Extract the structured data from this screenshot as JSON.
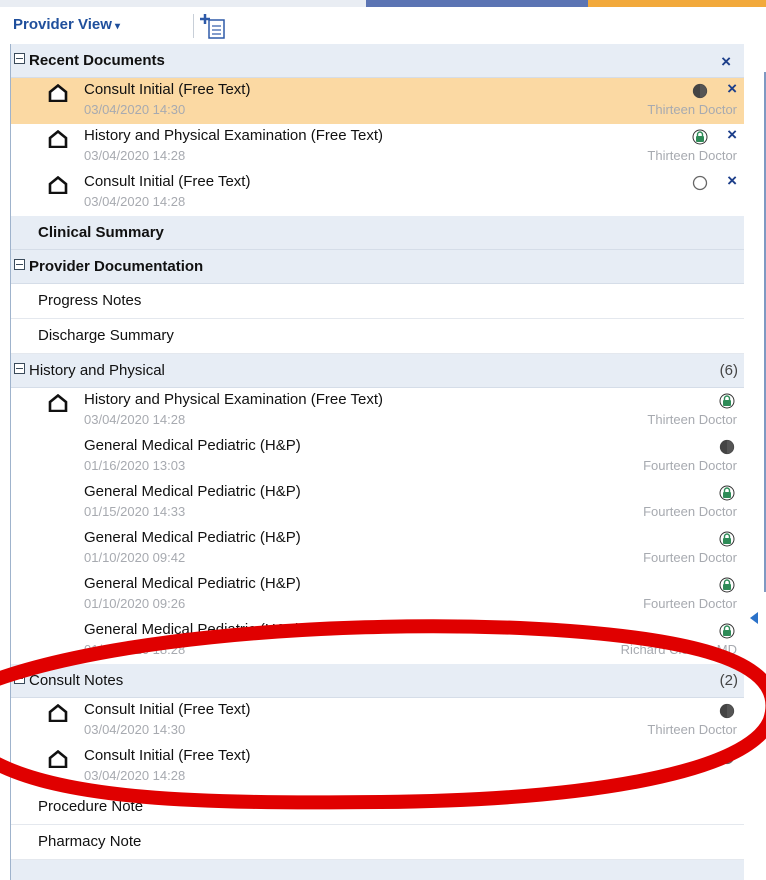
{
  "header": {
    "title": "Provider View",
    "caret": "▾",
    "new_doc_icon": "new-document-icon"
  },
  "colors": {
    "accent": "#1f4f9c",
    "selected_row": "#fbd9a3",
    "section_bg": "#e7edf5",
    "annotation": "#e00000",
    "lock_green": "#2e8b57"
  },
  "recent": {
    "label": "Recent Documents",
    "close": "×",
    "items": [
      {
        "title": "Consult Initial (Free Text)",
        "date": "03/04/2020 14:30",
        "author": "Thirteen Doctor",
        "status": "half",
        "close": "×"
      },
      {
        "title": "History and Physical Examination (Free Text)",
        "date": "03/04/2020 14:28",
        "author": "Thirteen Doctor",
        "status": "lock",
        "close": "×"
      },
      {
        "title": "Consult Initial (Free Text)",
        "date": "03/04/2020 14:28",
        "author": "",
        "status": "empty",
        "close": "×"
      }
    ]
  },
  "clinical_summary": {
    "label": "Clinical Summary"
  },
  "provider_doc": {
    "label": "Provider Documentation",
    "items": [
      {
        "label": "Progress Notes"
      },
      {
        "label": "Discharge Summary"
      }
    ]
  },
  "hp": {
    "label": "History and Physical",
    "count": "(6)",
    "items": [
      {
        "title": "History and Physical Examination (Free Text)",
        "date": "03/04/2020 14:28",
        "author": "Thirteen Doctor",
        "status": "lock",
        "home": true
      },
      {
        "title": "General Medical Pediatric (H&P)",
        "date": "01/16/2020 13:03",
        "author": "Fourteen Doctor",
        "status": "half",
        "home": false
      },
      {
        "title": "General Medical Pediatric (H&P)",
        "date": "01/15/2020 14:33",
        "author": "Fourteen Doctor",
        "status": "lock",
        "home": false
      },
      {
        "title": "General Medical Pediatric (H&P)",
        "date": "01/10/2020 09:42",
        "author": "Fourteen Doctor",
        "status": "lock",
        "home": false
      },
      {
        "title": "General Medical Pediatric (H&P)",
        "date": "01/10/2020 09:26",
        "author": "Fourteen Doctor",
        "status": "lock",
        "home": false
      },
      {
        "title": "General Medical Pediatric (H&P)",
        "date": "01/09/2020 18:28",
        "author": "Richard Clouse, MD",
        "status": "lock",
        "home": false
      }
    ]
  },
  "consult": {
    "label": "Consult Notes",
    "count": "(2)",
    "items": [
      {
        "title": "Consult Initial (Free Text)",
        "date": "03/04/2020 14:30",
        "author": "Thirteen Doctor",
        "status": "half",
        "home": true
      },
      {
        "title": "Consult Initial (Free Text)",
        "date": "03/04/2020 14:28",
        "author": "",
        "status": "empty",
        "home": true
      }
    ]
  },
  "more": [
    {
      "label": "Procedure Note"
    },
    {
      "label": "Pharmacy Note"
    }
  ]
}
